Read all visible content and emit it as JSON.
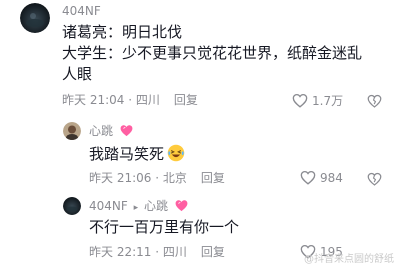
{
  "comment": {
    "username": "404NF",
    "line1": "诸葛亮：明日北伐",
    "line2": "大学生：少不更事只觉花花世界，纸醉金迷乱",
    "line3": "人眼",
    "time": "昨天 21:04 · 四川",
    "reply_label": "回复",
    "likes": "1.7万",
    "avatar_icon": "dark-avatar-icon"
  },
  "replies": [
    {
      "username": "心跳",
      "badge_icon": "pink-heart-icon",
      "text": "我踏马笑死",
      "emoji_icon": "laughing-tears-emoji-icon",
      "time": "昨天 21:06 · 北京",
      "reply_label": "回复",
      "likes": "984"
    },
    {
      "username": "404NF",
      "arrow": "▸",
      "target_username": "心跳",
      "badge_icon": "pink-heart-icon",
      "text": "不行一百万里有你一个",
      "time": "昨天 22:11 · 四川",
      "reply_label": "回复",
      "likes": "195"
    }
  ],
  "watermark": "@抖音来点圆的舒纸",
  "colors": {
    "primary_text": "#161823",
    "secondary_text": "#8a8b91",
    "badge_pink": "#ff5fa2",
    "background": "#ffffff"
  }
}
